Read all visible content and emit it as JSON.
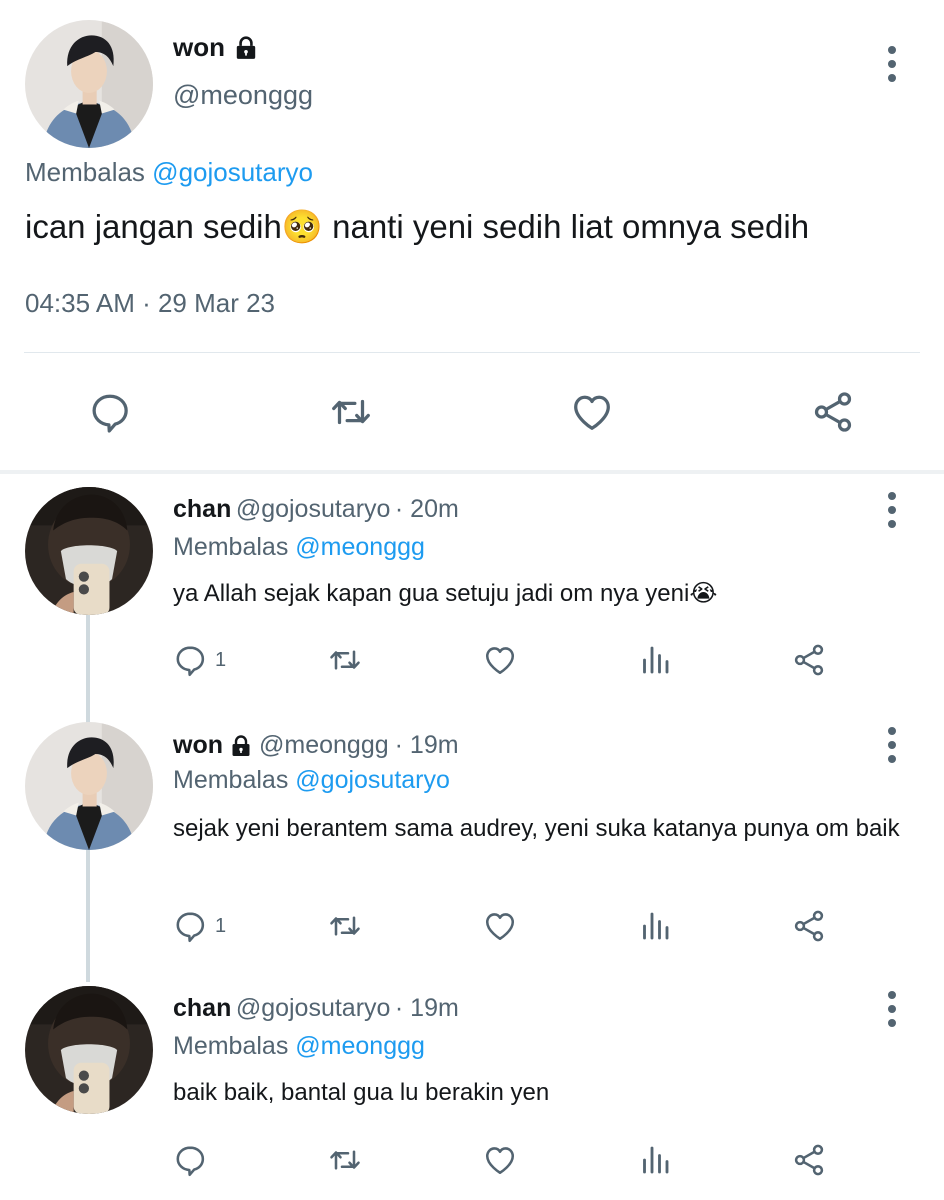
{
  "main_tweet": {
    "name": "won",
    "handle": "@meonggg",
    "reply_prefix": "Membalas",
    "reply_to": "@gojosutaryo",
    "text": "ican jangan sedih🥺 nanti yeni sedih liat omnya sedih",
    "timestamp": "04:35 AM · 29 Mar 23"
  },
  "replies": [
    {
      "name": "chan",
      "handle": "@gojosutaryo",
      "time": "· 20m",
      "reply_prefix": "Membalas",
      "reply_to": "@meonggg",
      "text": "ya Allah sejak kapan gua setuju jadi om nya yeni😭",
      "reply_count": "1"
    },
    {
      "name": "won",
      "handle": "@meonggg",
      "time": "· 19m",
      "reply_prefix": "Membalas",
      "reply_to": "@gojosutaryo",
      "text": "sejak yeni berantem sama audrey, yeni suka katanya punya om baik",
      "reply_count": "1"
    },
    {
      "name": "chan",
      "handle": "@gojosutaryo",
      "time": "· 19m",
      "reply_prefix": "Membalas",
      "reply_to": "@meonggg",
      "text": "baik baik, bantal gua lu berakin yen",
      "reply_count": ""
    }
  ],
  "icons": {
    "reply": "speech-bubble-icon",
    "retweet": "retweet-icon",
    "like": "heart-icon",
    "views": "bar-chart-icon",
    "share": "share-icon",
    "more": "vertical-dots-icon",
    "lock": "padlock-icon"
  },
  "colors": {
    "link": "#1d9bf0",
    "secondary_text": "#536471",
    "icon": "#536471",
    "thread_line": "#cfd9de"
  }
}
